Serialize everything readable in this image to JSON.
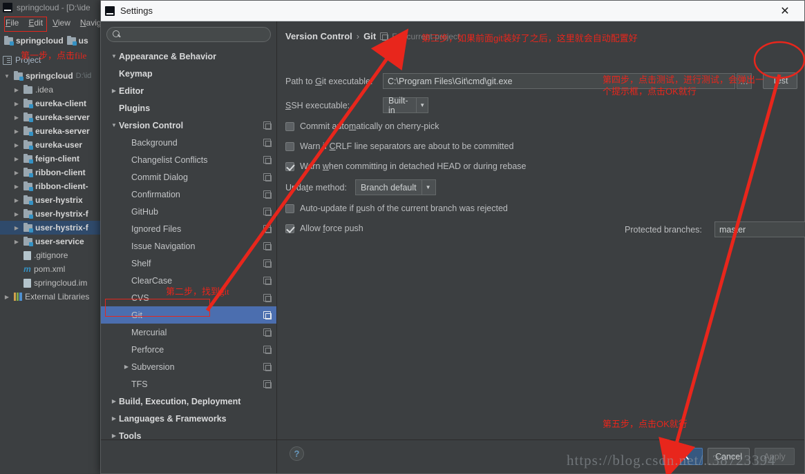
{
  "ide": {
    "title": "springcloud - [D:\\ide",
    "menus": [
      "File",
      "Edit",
      "View",
      "Navig"
    ],
    "breadcrumb": [
      "springcloud",
      "us"
    ],
    "toolwindow_label": "Project",
    "tree": [
      {
        "label": "springcloud",
        "sub": "D:\\id",
        "indent": 0,
        "twisty": "open",
        "icon": "folder-module",
        "bold": true,
        "selected": false
      },
      {
        "label": ".idea",
        "sub": "",
        "indent": 1,
        "twisty": "closed",
        "icon": "folder",
        "bold": false,
        "selected": false
      },
      {
        "label": "eureka-client",
        "sub": "",
        "indent": 1,
        "twisty": "closed",
        "icon": "folder-module",
        "bold": true,
        "selected": false
      },
      {
        "label": "eureka-server",
        "sub": "",
        "indent": 1,
        "twisty": "closed",
        "icon": "folder-module",
        "bold": true,
        "selected": false
      },
      {
        "label": "eureka-server",
        "sub": "",
        "indent": 1,
        "twisty": "closed",
        "icon": "folder-module",
        "bold": true,
        "selected": false
      },
      {
        "label": "eureka-user",
        "sub": "",
        "indent": 1,
        "twisty": "closed",
        "icon": "folder-module",
        "bold": true,
        "selected": false
      },
      {
        "label": "feign-client",
        "sub": "",
        "indent": 1,
        "twisty": "closed",
        "icon": "folder-module",
        "bold": true,
        "selected": false
      },
      {
        "label": "ribbon-client",
        "sub": "",
        "indent": 1,
        "twisty": "closed",
        "icon": "folder-module",
        "bold": true,
        "selected": false
      },
      {
        "label": "ribbon-client-",
        "sub": "",
        "indent": 1,
        "twisty": "closed",
        "icon": "folder-module",
        "bold": true,
        "selected": false
      },
      {
        "label": "user-hystrix",
        "sub": "",
        "indent": 1,
        "twisty": "closed",
        "icon": "folder-module",
        "bold": true,
        "selected": false
      },
      {
        "label": "user-hystrix-f",
        "sub": "",
        "indent": 1,
        "twisty": "closed",
        "icon": "folder-module",
        "bold": true,
        "selected": false
      },
      {
        "label": "user-hystrix-f",
        "sub": "",
        "indent": 1,
        "twisty": "closed",
        "icon": "folder-module",
        "bold": true,
        "selected": true
      },
      {
        "label": "user-service",
        "sub": "",
        "indent": 1,
        "twisty": "closed",
        "icon": "folder-module",
        "bold": true,
        "selected": false
      },
      {
        "label": ".gitignore",
        "sub": "",
        "indent": 1,
        "twisty": "none",
        "icon": "file",
        "bold": false,
        "selected": false
      },
      {
        "label": "pom.xml",
        "sub": "",
        "indent": 1,
        "twisty": "none",
        "icon": "maven",
        "bold": false,
        "selected": false
      },
      {
        "label": "springcloud.im",
        "sub": "",
        "indent": 1,
        "twisty": "none",
        "icon": "file",
        "bold": false,
        "selected": false
      },
      {
        "label": "External Libraries",
        "sub": "",
        "indent": 0,
        "twisty": "closed",
        "icon": "library",
        "bold": false,
        "selected": false
      }
    ]
  },
  "dialog": {
    "title": "Settings",
    "close_label": "✕",
    "search": {
      "value": "",
      "placeholder": ""
    },
    "nav": [
      {
        "label": "Appearance & Behavior",
        "level": 0,
        "twisty": "open",
        "copy": false,
        "selected": false
      },
      {
        "label": "Keymap",
        "level": 0,
        "twisty": "none",
        "copy": false,
        "selected": false
      },
      {
        "label": "Editor",
        "level": 0,
        "twisty": "closed",
        "copy": false,
        "selected": false
      },
      {
        "label": "Plugins",
        "level": 0,
        "twisty": "none",
        "copy": false,
        "selected": false
      },
      {
        "label": "Version Control",
        "level": 0,
        "twisty": "open",
        "copy": true,
        "selected": false
      },
      {
        "label": "Background",
        "level": 1,
        "twisty": "none",
        "copy": true,
        "selected": false
      },
      {
        "label": "Changelist Conflicts",
        "level": 1,
        "twisty": "none",
        "copy": true,
        "selected": false
      },
      {
        "label": "Commit Dialog",
        "level": 1,
        "twisty": "none",
        "copy": true,
        "selected": false
      },
      {
        "label": "Confirmation",
        "level": 1,
        "twisty": "none",
        "copy": true,
        "selected": false
      },
      {
        "label": "GitHub",
        "level": 1,
        "twisty": "none",
        "copy": true,
        "selected": false
      },
      {
        "label": "Ignored Files",
        "level": 1,
        "twisty": "none",
        "copy": true,
        "selected": false
      },
      {
        "label": "Issue Navigation",
        "level": 1,
        "twisty": "none",
        "copy": true,
        "selected": false
      },
      {
        "label": "Shelf",
        "level": 1,
        "twisty": "none",
        "copy": true,
        "selected": false
      },
      {
        "label": "ClearCase",
        "level": 1,
        "twisty": "none",
        "copy": true,
        "selected": false
      },
      {
        "label": "CVS",
        "level": 1,
        "twisty": "none",
        "copy": true,
        "selected": false
      },
      {
        "label": "Git",
        "level": 1,
        "twisty": "none",
        "copy": true,
        "selected": true
      },
      {
        "label": "Mercurial",
        "level": 1,
        "twisty": "none",
        "copy": true,
        "selected": false
      },
      {
        "label": "Perforce",
        "level": 1,
        "twisty": "none",
        "copy": true,
        "selected": false
      },
      {
        "label": "Subversion",
        "level": 1,
        "twisty": "closed",
        "copy": true,
        "selected": false
      },
      {
        "label": "TFS",
        "level": 1,
        "twisty": "none",
        "copy": true,
        "selected": false
      },
      {
        "label": "Build, Execution, Deployment",
        "level": 0,
        "twisty": "closed",
        "copy": false,
        "selected": false
      },
      {
        "label": "Languages & Frameworks",
        "level": 0,
        "twisty": "closed",
        "copy": false,
        "selected": false
      },
      {
        "label": "Tools",
        "level": 0,
        "twisty": "closed",
        "copy": false,
        "selected": false
      }
    ],
    "breadcrumb": {
      "parent": "Version Control",
      "separator": "›",
      "current": "Git",
      "scope": "For current project"
    },
    "form": {
      "git_path_label_pre": "Path to ",
      "git_path_label_mnemonic": "G",
      "git_path_label_post": "it executable:",
      "git_path_value": "C:\\Program Files\\Git\\cmd\\git.exe",
      "browse_label": "…",
      "test_label": "Test",
      "ssh_label_mnemonic": "S",
      "ssh_label_post": "SH executable:",
      "ssh_value": "Built-in",
      "checkbox_cherry": {
        "label_pre": "Commit auto",
        "label_u": "m",
        "label_post": "atically on cherry-pick",
        "checked": false
      },
      "checkbox_crlf": {
        "label_pre": "Warn if ",
        "label_u": "C",
        "label_post": "RLF line separators are about to be committed",
        "checked": false
      },
      "checkbox_detached": {
        "label_pre": "Warn ",
        "label_u": "w",
        "label_post": "hen committing in detached HEAD or during rebase",
        "checked": true
      },
      "update_label_pre": "Upda",
      "update_label_u": "t",
      "update_label_post": "e method:",
      "update_value": "Branch default",
      "checkbox_autoupdate": {
        "label_pre": "Auto-update if ",
        "label_u": "p",
        "label_post": "ush of the current branch was rejected",
        "checked": false
      },
      "checkbox_force_push": {
        "label_pre": "Allow ",
        "label_u": "f",
        "label_post": "orce push",
        "checked": true
      },
      "protected_label": "Protected branches:",
      "protected_value": "master",
      "protected_btn_icon": "import-icon"
    },
    "footer": {
      "help_label": "?",
      "ok_label": "OK",
      "cancel_label": "Cancel",
      "apply_label": "Apply"
    }
  },
  "annotations": {
    "accent_color": "#e8261c",
    "step1": "第一步，点击file",
    "step2": "第二步，找到git",
    "step3": "第三步，如果前面git装好了之后，这里就会自动配置好",
    "step4_line1": "第四步，点击测试，进行测试，会弹出一",
    "step4_line2": "个提示框，点击OK就行",
    "step5": "第五步，点击OK就行"
  },
  "watermark": "https://blog.csdn.net/..38723394"
}
